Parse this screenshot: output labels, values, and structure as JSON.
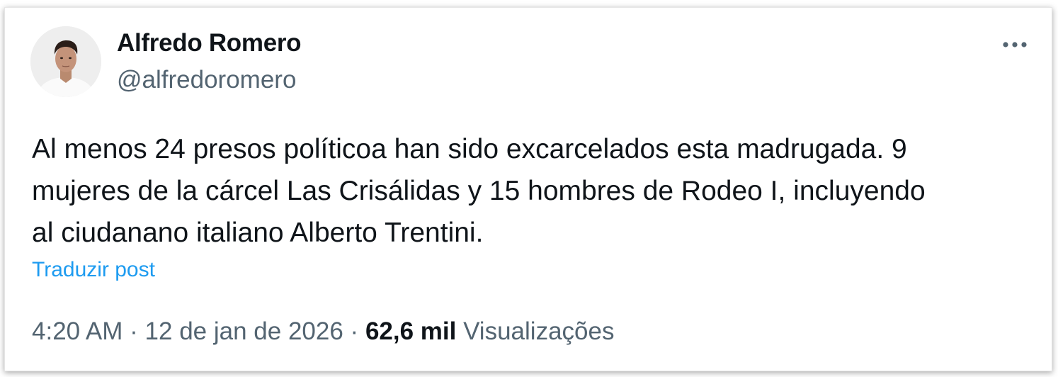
{
  "author": {
    "name": "Alfredo Romero",
    "handle": "@alfredoromero"
  },
  "tweet": {
    "lines": [
      "Al menos 24 presos políticoa han sido excarcelados esta madrugada. 9",
      "mujeres de la cárcel Las Crisálidas y 15 hombres de Rodeo I, incluyendo",
      "al ciudanano italiano Alberto Trentini."
    ],
    "translate_label": "Traduzir post"
  },
  "meta": {
    "time": "4:20 AM",
    "separator": "·",
    "date": "12 de jan de 2026",
    "views_count": "62,6 mil",
    "views_label": "Visualizações"
  },
  "colors": {
    "text": "#0f1419",
    "secondary": "#536471",
    "link": "#1d9bf0"
  },
  "icons": {
    "more": "more-horizontal-icon"
  }
}
